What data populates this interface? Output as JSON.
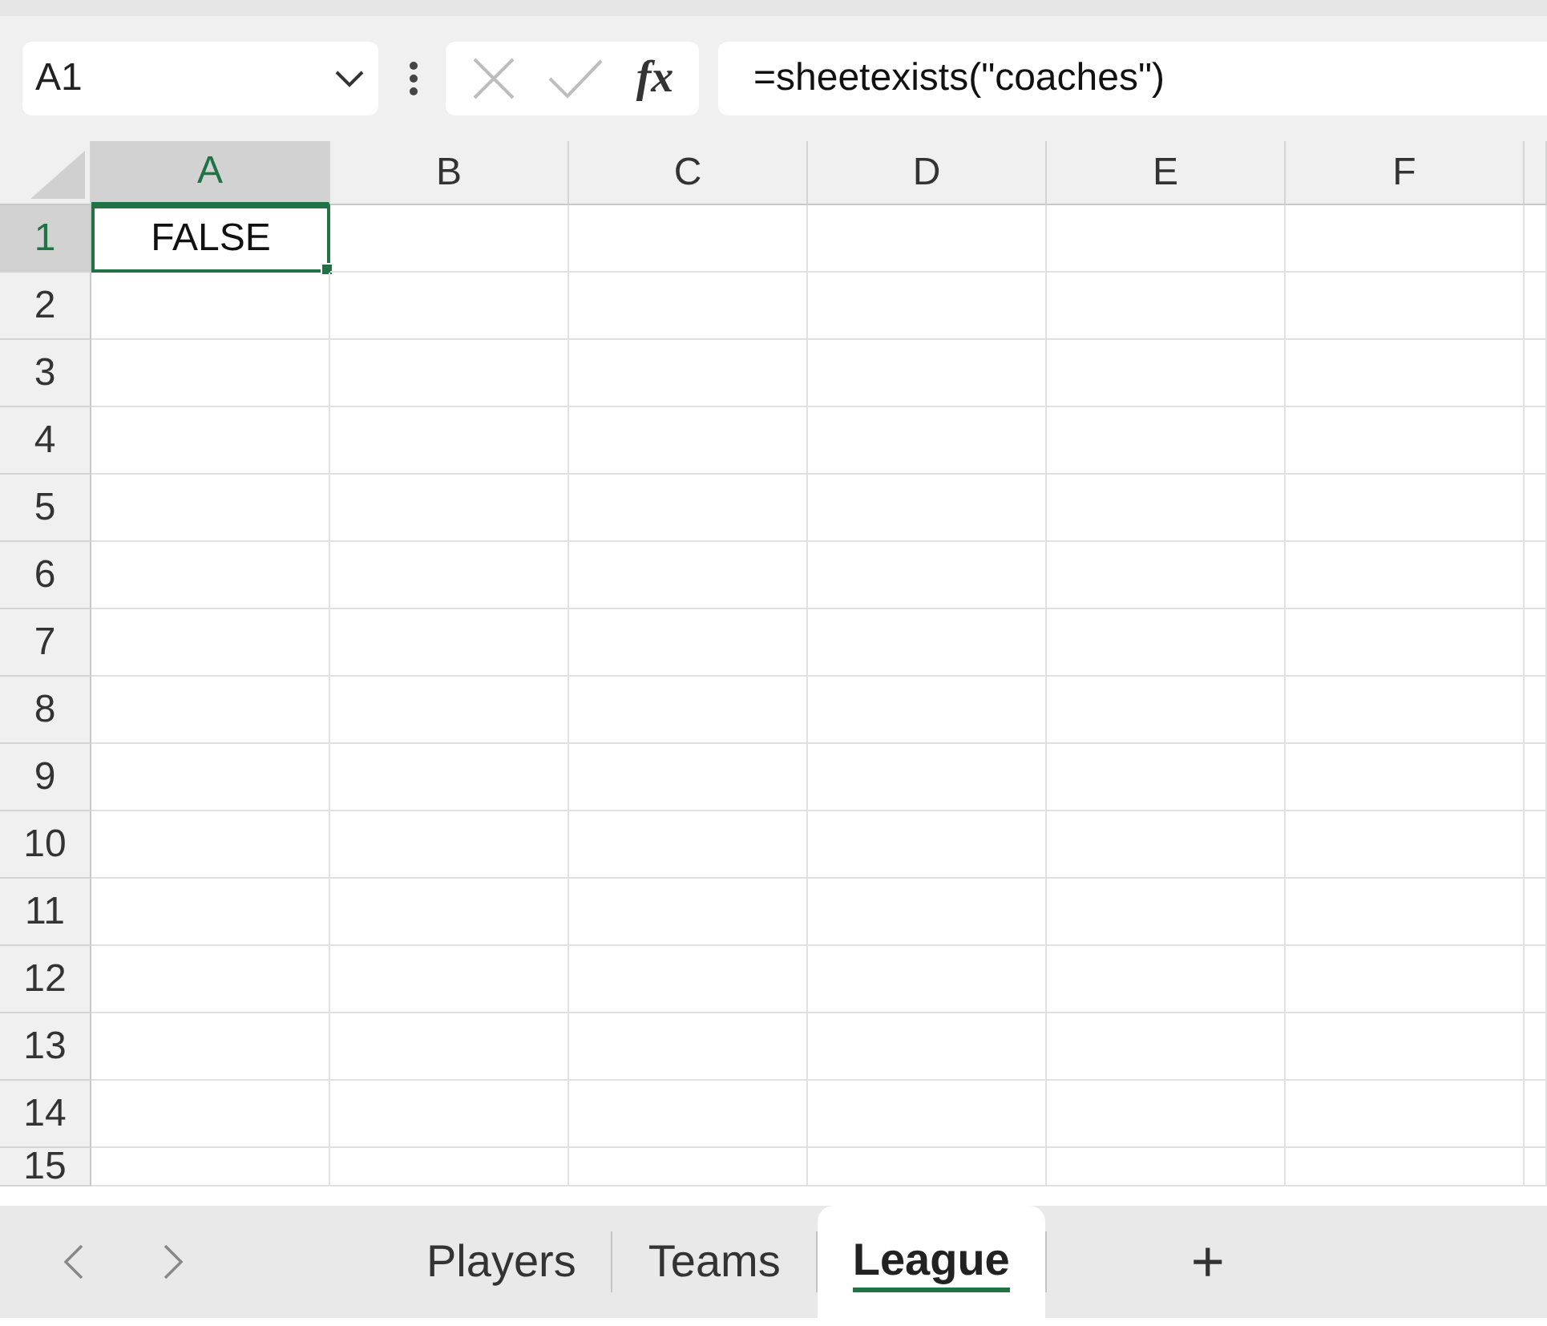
{
  "name_box": {
    "value": "A1"
  },
  "formula_bar": {
    "function_label": "fx",
    "value": "=sheetexists(\"coaches\")"
  },
  "columns": [
    {
      "label": "A",
      "selected": true
    },
    {
      "label": "B",
      "selected": false
    },
    {
      "label": "C",
      "selected": false
    },
    {
      "label": "D",
      "selected": false
    },
    {
      "label": "E",
      "selected": false
    },
    {
      "label": "F",
      "selected": false
    }
  ],
  "rows": [
    {
      "label": "1",
      "selected": true,
      "cells": [
        {
          "value": "FALSE",
          "selected": true
        }
      ]
    },
    {
      "label": "2",
      "selected": false
    },
    {
      "label": "3",
      "selected": false
    },
    {
      "label": "4",
      "selected": false
    },
    {
      "label": "5",
      "selected": false
    },
    {
      "label": "6",
      "selected": false
    },
    {
      "label": "7",
      "selected": false
    },
    {
      "label": "8",
      "selected": false
    },
    {
      "label": "9",
      "selected": false
    },
    {
      "label": "10",
      "selected": false
    },
    {
      "label": "11",
      "selected": false
    },
    {
      "label": "12",
      "selected": false
    },
    {
      "label": "13",
      "selected": false
    },
    {
      "label": "14",
      "selected": false
    },
    {
      "label": "15",
      "selected": false
    }
  ],
  "sheet_tabs": [
    {
      "label": "Players",
      "selected": false
    },
    {
      "label": "Teams",
      "selected": false
    },
    {
      "label": "League",
      "selected": true
    }
  ],
  "add_sheet": {
    "label": "+"
  }
}
